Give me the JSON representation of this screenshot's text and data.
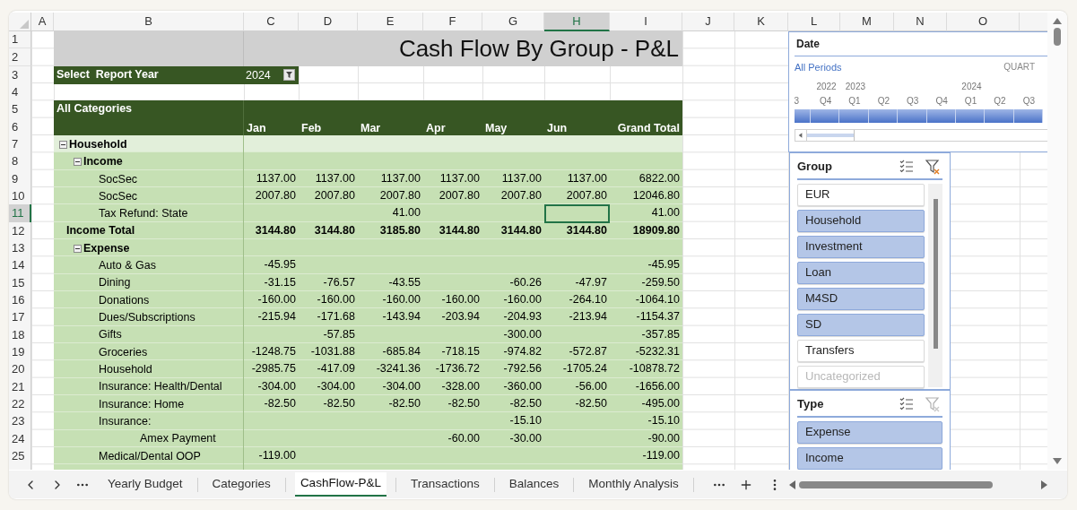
{
  "column_headers": [
    {
      "label": "A",
      "selected": false
    },
    {
      "label": "B",
      "selected": false
    },
    {
      "label": "C",
      "selected": false
    },
    {
      "label": "D",
      "selected": false
    },
    {
      "label": "E",
      "selected": false
    },
    {
      "label": "F",
      "selected": false
    },
    {
      "label": "G",
      "selected": false
    },
    {
      "label": "H",
      "selected": true
    },
    {
      "label": "I",
      "selected": false
    },
    {
      "label": "J",
      "selected": false
    },
    {
      "label": "K",
      "selected": false
    },
    {
      "label": "L",
      "selected": false
    },
    {
      "label": "M",
      "selected": false
    },
    {
      "label": "N",
      "selected": false
    },
    {
      "label": "O",
      "selected": false
    }
  ],
  "row_headers": [
    {
      "label": "1",
      "selected": false
    },
    {
      "label": "2",
      "selected": false
    },
    {
      "label": "3",
      "selected": false
    },
    {
      "label": "4",
      "selected": false
    },
    {
      "label": "5",
      "selected": false
    },
    {
      "label": "6",
      "selected": false
    },
    {
      "label": "7",
      "selected": false
    },
    {
      "label": "8",
      "selected": false
    },
    {
      "label": "9",
      "selected": false
    },
    {
      "label": "10",
      "selected": false
    },
    {
      "label": "11",
      "selected": true
    },
    {
      "label": "12",
      "selected": false
    },
    {
      "label": "13",
      "selected": false
    },
    {
      "label": "14",
      "selected": false
    },
    {
      "label": "15",
      "selected": false
    },
    {
      "label": "16",
      "selected": false
    },
    {
      "label": "17",
      "selected": false
    },
    {
      "label": "18",
      "selected": false
    },
    {
      "label": "19",
      "selected": false
    },
    {
      "label": "20",
      "selected": false
    },
    {
      "label": "21",
      "selected": false
    },
    {
      "label": "22",
      "selected": false
    },
    {
      "label": "23",
      "selected": false
    },
    {
      "label": "24",
      "selected": false
    },
    {
      "label": "25",
      "selected": false
    }
  ],
  "title": "Cash Flow By Group - P&L",
  "report_year": {
    "label": "Select  Report Year",
    "value": "2024"
  },
  "pivot": {
    "corner": "All Categories",
    "columns": [
      "Jan",
      "Feb",
      "Mar",
      "Apr",
      "May",
      "Jun",
      "Grand Total"
    ],
    "rows": [
      {
        "kind": "group",
        "label": "Household",
        "expanded": true,
        "children": [
          {
            "kind": "group",
            "label": "Income",
            "expanded": true,
            "children": [
              {
                "kind": "item",
                "label": "SocSec",
                "values": {
                  "jan": "1137.00",
                  "feb": "1137.00",
                  "mar": "1137.00",
                  "apr": "1137.00",
                  "may": "1137.00",
                  "jun": "1137.00",
                  "grand_total": "6822.00"
                }
              },
              {
                "kind": "item",
                "label": "SocSec",
                "values": {
                  "jan": "2007.80",
                  "feb": "2007.80",
                  "mar": "2007.80",
                  "apr": "2007.80",
                  "may": "2007.80",
                  "jun": "2007.80",
                  "grand_total": "12046.80"
                }
              },
              {
                "kind": "item",
                "label": "Tax Refund: State",
                "values": {
                  "mar": "41.00",
                  "grand_total": "41.00"
                }
              }
            ]
          },
          {
            "kind": "total",
            "label": "Income Total",
            "values": {
              "jan": "3144.80",
              "feb": "3144.80",
              "mar": "3185.80",
              "apr": "3144.80",
              "may": "3144.80",
              "jun": "3144.80",
              "grand_total": "18909.80"
            }
          },
          {
            "kind": "group",
            "label": "Expense",
            "expanded": true,
            "children": [
              {
                "kind": "item",
                "label": "Auto & Gas",
                "values": {
                  "jan": "-45.95",
                  "grand_total": "-45.95"
                }
              },
              {
                "kind": "item",
                "label": "Dining",
                "values": {
                  "jan": "-31.15",
                  "feb": "-76.57",
                  "mar": "-43.55",
                  "may": "-60.26",
                  "jun": "-47.97",
                  "grand_total": "-259.50"
                }
              },
              {
                "kind": "item",
                "label": "Donations",
                "values": {
                  "jan": "-160.00",
                  "feb": "-160.00",
                  "mar": "-160.00",
                  "apr": "-160.00",
                  "may": "-160.00",
                  "jun": "-264.10",
                  "grand_total": "-1064.10"
                }
              },
              {
                "kind": "item",
                "label": "Dues/Subscriptions",
                "values": {
                  "jan": "-215.94",
                  "feb": "-171.68",
                  "mar": "-143.94",
                  "apr": "-203.94",
                  "may": "-204.93",
                  "jun": "-213.94",
                  "grand_total": "-1154.37"
                }
              },
              {
                "kind": "item",
                "label": "Gifts",
                "values": {
                  "feb": "-57.85",
                  "may": "-300.00",
                  "grand_total": "-357.85"
                }
              },
              {
                "kind": "item",
                "label": "Groceries",
                "values": {
                  "jan": "-1248.75",
                  "feb": "-1031.88",
                  "mar": "-685.84",
                  "apr": "-718.15",
                  "may": "-974.82",
                  "jun": "-572.87",
                  "grand_total": "-5232.31"
                }
              },
              {
                "kind": "item",
                "label": "Household",
                "values": {
                  "jan": "-2985.75",
                  "feb": "-417.09",
                  "mar": "-3241.36",
                  "apr": "-1736.72",
                  "may": "-792.56",
                  "jun": "-1705.24",
                  "grand_total": "-10878.72"
                }
              },
              {
                "kind": "item",
                "label": "Insurance: Health/Dental",
                "values": {
                  "jan": "-304.00",
                  "feb": "-304.00",
                  "mar": "-304.00",
                  "apr": "-328.00",
                  "may": "-360.00",
                  "jun": "-56.00",
                  "grand_total": "-1656.00"
                }
              },
              {
                "kind": "item",
                "label": "Insurance: Home",
                "values": {
                  "jan": "-82.50",
                  "feb": "-82.50",
                  "mar": "-82.50",
                  "apr": "-82.50",
                  "may": "-82.50",
                  "jun": "-82.50",
                  "grand_total": "-495.00"
                }
              },
              {
                "kind": "item",
                "label": "Insurance:",
                "values": {
                  "may": "-15.10",
                  "grand_total": "-15.10"
                }
              },
              {
                "kind": "continuation",
                "label": "Amex Payment",
                "values": {
                  "apr": "-60.00",
                  "may": "-30.00",
                  "grand_total": "-90.00"
                }
              },
              {
                "kind": "item",
                "label": "Medical/Dental OOP",
                "values": {
                  "jan": "-119.00",
                  "grand_total": "-119.00"
                }
              }
            ]
          }
        ]
      }
    ]
  },
  "date_slicer": {
    "title": "Date",
    "selection": "All Periods",
    "level": "QUART",
    "periods": [
      {
        "label": "3",
        "selected": true
      },
      {
        "label": "Q4",
        "year": "2022",
        "selected": true
      },
      {
        "label": "Q1",
        "year": "2023",
        "selected": true
      },
      {
        "label": "Q2",
        "selected": true
      },
      {
        "label": "Q3",
        "selected": true
      },
      {
        "label": "Q4",
        "selected": true
      },
      {
        "label": "Q1",
        "year": "2024",
        "selected": true
      },
      {
        "label": "Q2",
        "selected": true
      },
      {
        "label": "Q3",
        "selected": true
      }
    ]
  },
  "group_slicer": {
    "title": "Group",
    "filtered": true,
    "items": [
      {
        "label": "EUR",
        "selected": false,
        "disabled": false
      },
      {
        "label": "Household",
        "selected": true,
        "disabled": false
      },
      {
        "label": "Investment",
        "selected": true,
        "disabled": false
      },
      {
        "label": "Loan",
        "selected": true,
        "disabled": false
      },
      {
        "label": "M4SD",
        "selected": true,
        "disabled": false
      },
      {
        "label": "SD",
        "selected": true,
        "disabled": false
      },
      {
        "label": "Transfers",
        "selected": false,
        "disabled": false
      },
      {
        "label": "Uncategorized",
        "selected": false,
        "disabled": true
      }
    ]
  },
  "type_slicer": {
    "title": "Type",
    "filtered": false,
    "items": [
      {
        "label": "Expense",
        "selected": true,
        "disabled": false
      },
      {
        "label": "Income",
        "selected": true,
        "disabled": false
      }
    ]
  },
  "sheet_tabs": [
    {
      "label": "Yearly Budget",
      "selected": false
    },
    {
      "label": "Categories",
      "selected": false
    },
    {
      "label": "CashFlow-P&L",
      "selected": true
    },
    {
      "label": "Transactions",
      "selected": false
    },
    {
      "label": "Balances",
      "selected": false
    },
    {
      "label": "Monthly Analysis",
      "selected": false
    }
  ]
}
